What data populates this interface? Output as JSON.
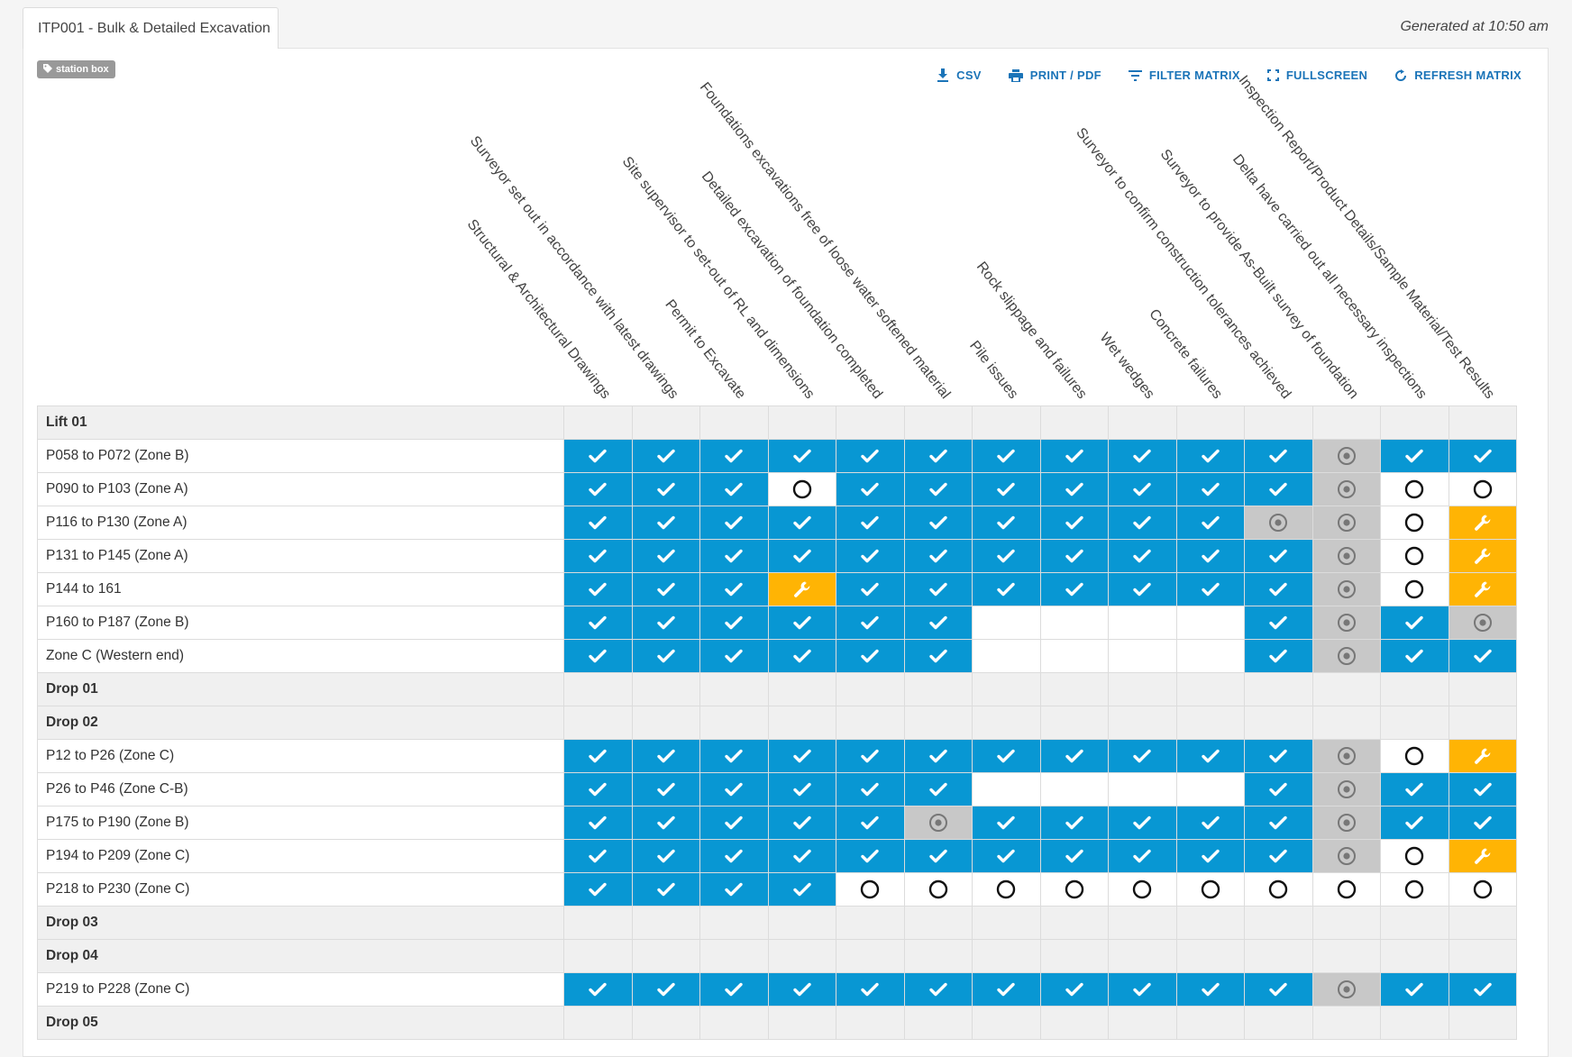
{
  "tab": {
    "title": "ITP001 - Bulk & Detailed Excavation"
  },
  "generated": "Generated at 10:50 am",
  "tag": {
    "label": "station box"
  },
  "toolbar": {
    "csv": "CSV",
    "print": "PRINT / PDF",
    "filter": "FILTER MATRIX",
    "fullscreen": "FULLSCREEN",
    "refresh": "REFRESH MATRIX"
  },
  "columns": [
    "Structural & Architectural Drawings",
    "Surveyor set out in accordance with latest drawings",
    "Permit to Excavate",
    "Site supervisor to set-out of RL and dimensions",
    "Detailed excavation of foundation completed",
    "Foundations excavations free of loose water softened material",
    "Pile issues",
    "Rock slippage and failures",
    "Wet wedges",
    "Concrete failures",
    "Surveyor to confirm construction tolerances achieved",
    "Surveyor to provide As-Built survey of foundation",
    "Delta have carried out all necessary inspections",
    "Inspection Report/Product Details/Sample Material/Test Results"
  ],
  "legend": {
    "D": "check-icon",
    "P": "partial-icon",
    "O": "open-circle-icon",
    "W": "wrench-icon",
    "E": "empty"
  },
  "colors": {
    "done": "#0897d3",
    "partial": "#c8c8c8",
    "issue": "#ffb404"
  },
  "rows": [
    {
      "type": "group",
      "label": "Lift 01"
    },
    {
      "type": "row",
      "label": "P058 to P072 (Zone B)",
      "cells": "DDDDDDDDDDDPDD"
    },
    {
      "type": "row",
      "label": "P090 to P103 (Zone A)",
      "cells": "DDDODDDDDDDPOO"
    },
    {
      "type": "row",
      "label": "P116 to P130 (Zone A)",
      "cells": "DDDDDDDDDDPPOW"
    },
    {
      "type": "row",
      "label": "P131 to P145 (Zone A)",
      "cells": "DDDDDDDDDDDPOW"
    },
    {
      "type": "row",
      "label": "P144 to 161",
      "cells": "DDDWDDDDDDDPOW"
    },
    {
      "type": "row",
      "label": "P160 to P187 (Zone B)",
      "cells": "DDDDDDEEEEDPDP"
    },
    {
      "type": "row",
      "label": "Zone C (Western end)",
      "cells": "DDDDDDEEEEDPDD"
    },
    {
      "type": "group",
      "label": "Drop 01"
    },
    {
      "type": "group",
      "label": "Drop 02"
    },
    {
      "type": "row",
      "label": "P12 to P26 (Zone C)",
      "cells": "DDDDDDDDDDDPOW"
    },
    {
      "type": "row",
      "label": "P26 to P46 (Zone C-B)",
      "cells": "DDDDDDEEEEDPDD"
    },
    {
      "type": "row",
      "label": "P175 to P190 (Zone B)",
      "cells": "DDDDDPDDDDDPDD"
    },
    {
      "type": "row",
      "label": "P194 to P209 (Zone C)",
      "cells": "DDDDDDDDDDDPOW"
    },
    {
      "type": "row",
      "label": "P218 to P230 (Zone C)",
      "cells": "DDDDOOOOOOOOOO"
    },
    {
      "type": "group",
      "label": "Drop 03"
    },
    {
      "type": "group",
      "label": "Drop 04"
    },
    {
      "type": "row",
      "label": "P219 to P228 (Zone C)",
      "cells": "DDDDDDDDDDDPDD"
    },
    {
      "type": "group",
      "label": "Drop 05"
    }
  ]
}
